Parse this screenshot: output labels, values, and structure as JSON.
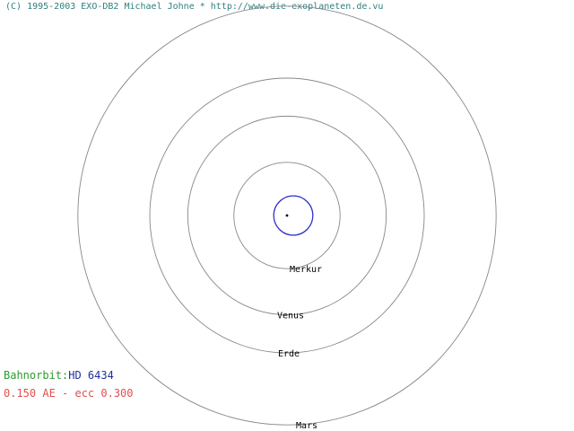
{
  "copyright": "(C) 1995-2003 EXO-DB2 Michael Johne * http://www.die-exoplaneten.de.vu",
  "info": {
    "orbit_label": "Bahnorbit:",
    "star_name": "HD 6434",
    "orbit_params": "0.150 AE - ecc 0.300"
  },
  "colors": {
    "planet_orbit": "#3333cc",
    "reference_orbit": "#888888",
    "label_green": "#2e9a2e",
    "label_blue": "#1f2f9f",
    "label_red": "#e05050"
  },
  "diagram": {
    "reference_orbits": [
      {
        "name": "Merkur",
        "au": 0.387
      },
      {
        "name": "Venus",
        "au": 0.723
      },
      {
        "name": "Erde",
        "au": 1.0
      },
      {
        "name": "Mars",
        "au": 1.524
      }
    ],
    "planet_orbit": {
      "semi_major_axis_au": 0.15,
      "eccentricity": 0.3
    }
  }
}
